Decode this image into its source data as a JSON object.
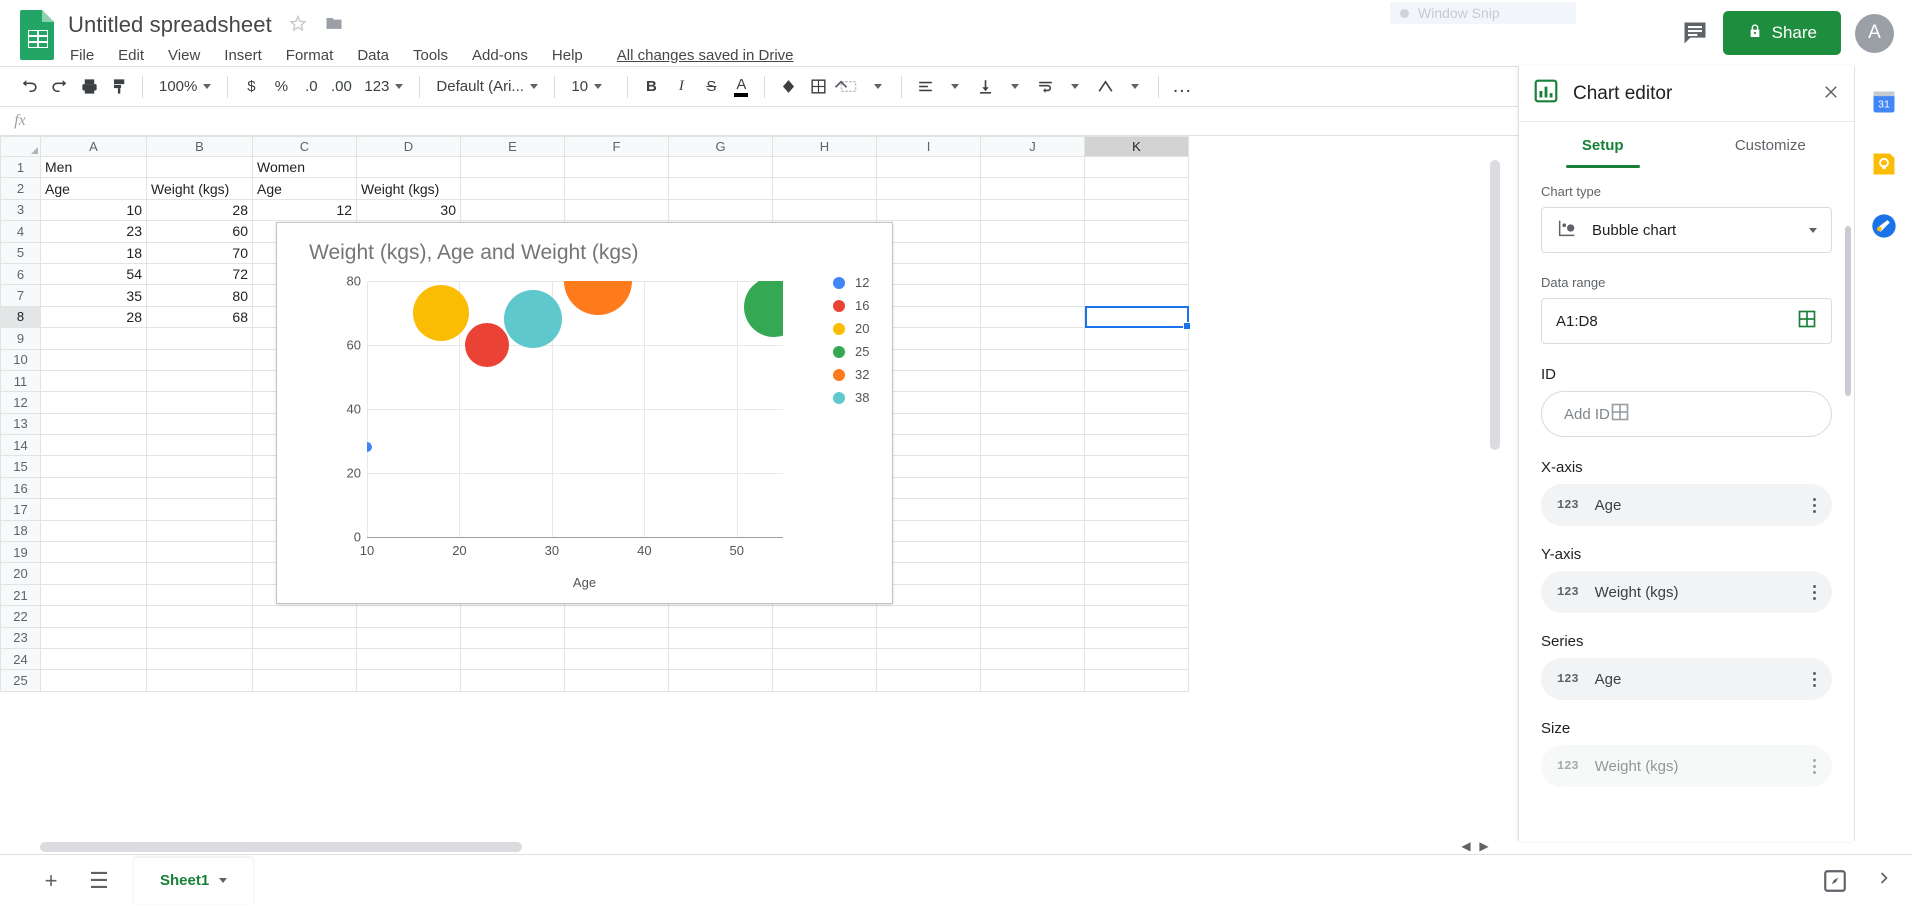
{
  "app": {
    "doc_title": "Untitled spreadsheet",
    "save_status": "All changes saved in Drive",
    "menus": [
      "File",
      "Edit",
      "View",
      "Insert",
      "Format",
      "Data",
      "Tools",
      "Add-ons",
      "Help"
    ],
    "window_snip_label": "Window Snip",
    "share_label": "Share",
    "avatar_letter": "A"
  },
  "toolbar": {
    "zoom": "100%",
    "font": "Default (Ari...",
    "font_size": "10",
    "number_format": "123",
    "bold": "B",
    "italic": "I",
    "strikethrough": "S",
    "text_color": "A",
    "more": "…"
  },
  "formula_bar": {
    "fx": "fx",
    "value": "",
    "placeholder": ""
  },
  "grid": {
    "columns": [
      "A",
      "B",
      "C",
      "D",
      "E",
      "F",
      "G",
      "H",
      "I",
      "J",
      "K"
    ],
    "selected_column": "K",
    "selected_row": "8",
    "selected_cell": "K8",
    "rows": [
      {
        "n": "1",
        "cells": [
          "Men",
          "",
          "Women",
          "",
          "",
          "",
          "",
          "",
          "",
          "",
          ""
        ]
      },
      {
        "n": "2",
        "cells": [
          "Age",
          "Weight (kgs)",
          "Age",
          "Weight (kgs)",
          "",
          "",
          "",
          "",
          "",
          "",
          ""
        ]
      },
      {
        "n": "3",
        "cells": [
          "10",
          "28",
          "12",
          "30",
          "",
          "",
          "",
          "",
          "",
          "",
          ""
        ],
        "numeric": [
          0,
          1,
          2,
          3
        ]
      },
      {
        "n": "4",
        "cells": [
          "23",
          "60",
          "",
          "",
          "",
          "",
          "",
          "",
          "",
          "",
          ""
        ],
        "numeric": [
          0,
          1
        ]
      },
      {
        "n": "5",
        "cells": [
          "18",
          "70",
          "",
          "",
          "",
          "",
          "",
          "",
          "",
          "",
          ""
        ],
        "numeric": [
          0,
          1
        ]
      },
      {
        "n": "6",
        "cells": [
          "54",
          "72",
          "",
          "",
          "",
          "",
          "",
          "",
          "",
          "",
          ""
        ],
        "numeric": [
          0,
          1
        ]
      },
      {
        "n": "7",
        "cells": [
          "35",
          "80",
          "",
          "",
          "",
          "",
          "",
          "",
          "",
          "",
          ""
        ],
        "numeric": [
          0,
          1
        ]
      },
      {
        "n": "8",
        "cells": [
          "28",
          "68",
          "",
          "",
          "",
          "",
          "",
          "",
          "",
          "",
          ""
        ],
        "numeric": [
          0,
          1
        ]
      },
      {
        "n": "9",
        "cells": [
          "",
          "",
          "",
          "",
          "",
          "",
          "",
          "",
          "",
          "",
          ""
        ]
      },
      {
        "n": "10",
        "cells": [
          "",
          "",
          "",
          "",
          "",
          "",
          "",
          "",
          "",
          "",
          ""
        ]
      },
      {
        "n": "11",
        "cells": [
          "",
          "",
          "",
          "",
          "",
          "",
          "",
          "",
          "",
          "",
          ""
        ]
      },
      {
        "n": "12",
        "cells": [
          "",
          "",
          "",
          "",
          "",
          "",
          "",
          "",
          "",
          "",
          ""
        ]
      },
      {
        "n": "13",
        "cells": [
          "",
          "",
          "",
          "",
          "",
          "",
          "",
          "",
          "",
          "",
          ""
        ]
      },
      {
        "n": "14",
        "cells": [
          "",
          "",
          "",
          "",
          "",
          "",
          "",
          "",
          "",
          "",
          ""
        ]
      },
      {
        "n": "15",
        "cells": [
          "",
          "",
          "",
          "",
          "",
          "",
          "",
          "",
          "",
          "",
          ""
        ]
      },
      {
        "n": "16",
        "cells": [
          "",
          "",
          "",
          "",
          "",
          "",
          "",
          "",
          "",
          "",
          ""
        ]
      },
      {
        "n": "17",
        "cells": [
          "",
          "",
          "",
          "",
          "",
          "",
          "",
          "",
          "",
          "",
          ""
        ]
      },
      {
        "n": "18",
        "cells": [
          "",
          "",
          "",
          "",
          "",
          "",
          "",
          "",
          "",
          "",
          ""
        ]
      },
      {
        "n": "19",
        "cells": [
          "",
          "",
          "",
          "",
          "",
          "",
          "",
          "",
          "",
          "",
          ""
        ]
      },
      {
        "n": "20",
        "cells": [
          "",
          "",
          "",
          "",
          "",
          "",
          "",
          "",
          "",
          "",
          ""
        ]
      },
      {
        "n": "21",
        "cells": [
          "",
          "",
          "",
          "",
          "",
          "",
          "",
          "",
          "",
          "",
          ""
        ]
      },
      {
        "n": "22",
        "cells": [
          "",
          "",
          "",
          "",
          "",
          "",
          "",
          "",
          "",
          "",
          ""
        ]
      },
      {
        "n": "23",
        "cells": [
          "",
          "",
          "",
          "",
          "",
          "",
          "",
          "",
          "",
          "",
          ""
        ]
      },
      {
        "n": "24",
        "cells": [
          "",
          "",
          "",
          "",
          "",
          "",
          "",
          "",
          "",
          "",
          ""
        ]
      },
      {
        "n": "25",
        "cells": [
          "",
          "",
          "",
          "",
          "",
          "",
          "",
          "",
          "",
          "",
          ""
        ]
      }
    ]
  },
  "chart_data": {
    "type": "scatter",
    "title": "Weight (kgs), Age  and Weight (kgs)",
    "xlabel": "Age",
    "ylabel": "",
    "xlim": [
      10,
      55
    ],
    "ylim": [
      0,
      80
    ],
    "xticks": [
      "10",
      "20",
      "30",
      "40",
      "50"
    ],
    "yticks": [
      "0",
      "20",
      "40",
      "60",
      "80"
    ],
    "grid": true,
    "legend_position": "right",
    "legend_title": "",
    "legend": [
      {
        "label": "12",
        "color": "#4285f4"
      },
      {
        "label": "16",
        "color": "#ea4335"
      },
      {
        "label": "20",
        "color": "#fbbc04"
      },
      {
        "label": "25",
        "color": "#34a853"
      },
      {
        "label": "32",
        "color": "#ff7a1a"
      },
      {
        "label": "38",
        "color": "#5ec8cd"
      }
    ],
    "points": [
      {
        "x": 10,
        "y": 28,
        "size": 12,
        "color": "#4285f4",
        "r": 5
      },
      {
        "x": 23,
        "y": 60,
        "size": 16,
        "color": "#ea4335",
        "r": 22
      },
      {
        "x": 18,
        "y": 70,
        "size": 20,
        "color": "#fbbc04",
        "r": 28
      },
      {
        "x": 54,
        "y": 72,
        "size": 25,
        "color": "#34a853",
        "r": 30
      },
      {
        "x": 35,
        "y": 80,
        "size": 32,
        "color": "#ff7a1a",
        "r": 34
      },
      {
        "x": 28,
        "y": 68,
        "size": 38,
        "color": "#5ec8cd",
        "r": 29
      }
    ]
  },
  "chart_editor": {
    "panel_title": "Chart editor",
    "tabs": [
      {
        "label": "Setup",
        "active": true
      },
      {
        "label": "Customize",
        "active": false
      }
    ],
    "fields": {
      "chart_type_label": "Chart type",
      "chart_type_value": "Bubble chart",
      "data_range_label": "Data range",
      "data_range_value": "A1:D8",
      "id_label": "ID",
      "id_placeholder": "Add ID",
      "x_axis_label": "X-axis",
      "x_axis_value": "Age",
      "y_axis_label": "Y-axis",
      "y_axis_value": "Weight (kgs)",
      "series_label": "Series",
      "series_value": "Age",
      "size_label": "Size",
      "size_value": "Weight (kgs)",
      "type_marker": "123"
    }
  },
  "bottom": {
    "sheet_name": "Sheet1",
    "add_sheet": "+",
    "all_sheets": "☰"
  }
}
